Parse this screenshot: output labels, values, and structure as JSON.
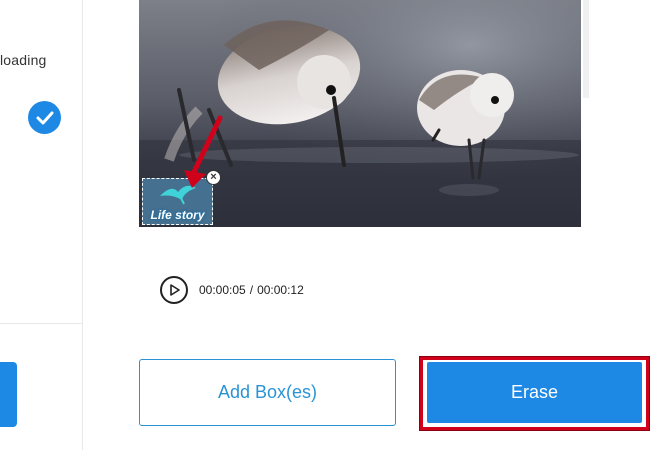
{
  "sidebar": {
    "uploading_text": "ploading",
    "check_icon": "checkmark-circle-icon",
    "accent_color": "#1e88e5"
  },
  "video": {
    "watermark_text": "Life story",
    "close_icon": "close-icon",
    "annotation_arrow_color": "#d0021b"
  },
  "player": {
    "play_icon": "play-icon",
    "current_time": "00:00:05",
    "separator": "/",
    "total_time": "00:00:12"
  },
  "actions": {
    "add_boxes_label": "Add Box(es)",
    "erase_label": "Erase",
    "highlight_color": "#d0021b"
  }
}
